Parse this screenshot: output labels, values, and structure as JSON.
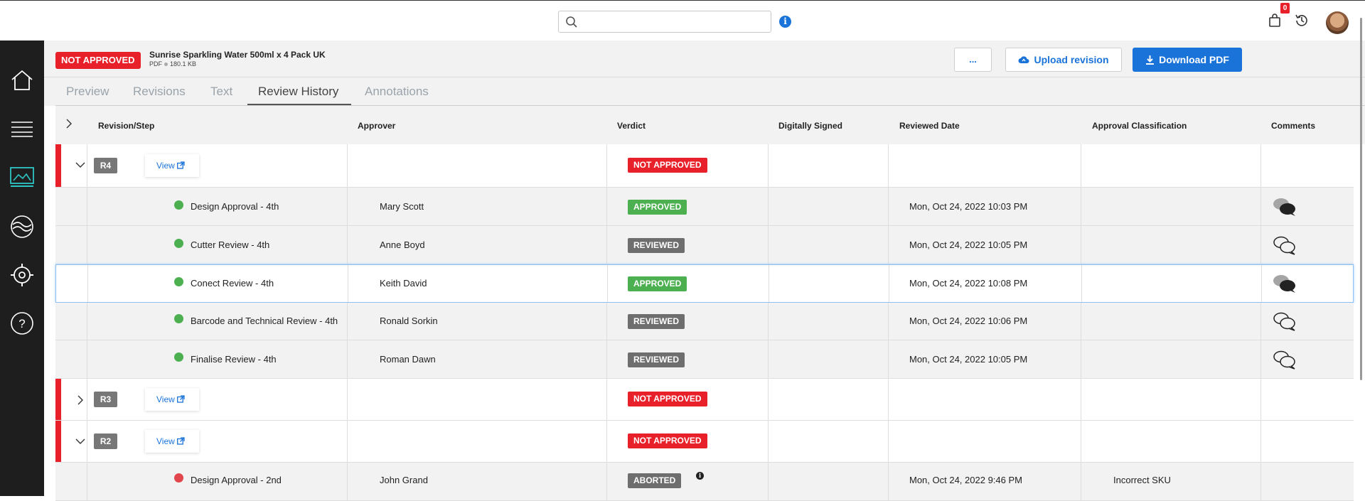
{
  "topbar": {
    "search_placeholder": "",
    "info_glyph": "i",
    "cart_count": "0"
  },
  "sidebar": {
    "items": [
      "home",
      "list",
      "artwork",
      "layers",
      "settings",
      "help"
    ],
    "active": "artwork"
  },
  "document": {
    "status": "NOT APPROVED",
    "title": "Sunrise Sparkling Water 500ml x 4 Pack UK",
    "file_type": "PDF",
    "file_size": "180.1 KB"
  },
  "actions": {
    "more_label": "...",
    "upload_label": "Upload revision",
    "download_label": "Download PDF"
  },
  "tabs": [
    "Preview",
    "Revisions",
    "Text",
    "Review History",
    "Annotations"
  ],
  "active_tab": "Review History",
  "columns": {
    "step": "Revision/Step",
    "approver": "Approver",
    "verdict": "Verdict",
    "signed": "Digitally Signed",
    "date": "Reviewed Date",
    "classification": "Approval Classification",
    "comments": "Comments"
  },
  "revisions": [
    {
      "id": "R4",
      "view_label": "View",
      "verdict": "NOT APPROVED",
      "expanded": true,
      "steps": [
        {
          "name": "Design Approval - 4th",
          "approver": "Mary Scott",
          "verdict": "APPROVED",
          "date": "Mon, Oct 24, 2022 10:03 PM",
          "classification": "",
          "has_comments": true
        },
        {
          "name": "Cutter Review - 4th",
          "approver": "Anne Boyd",
          "verdict": "REVIEWED",
          "date": "Mon, Oct 24, 2022 10:05 PM",
          "classification": "",
          "has_comments": false
        },
        {
          "name": "Conect Review - 4th",
          "approver": "Keith David",
          "verdict": "APPROVED",
          "date": "Mon, Oct 24, 2022 10:08 PM",
          "classification": "",
          "has_comments": true,
          "selected": true
        },
        {
          "name": "Barcode and Technical Review - 4th",
          "approver": "Ronald Sorkin",
          "verdict": "REVIEWED",
          "date": "Mon, Oct 24, 2022 10:06 PM",
          "classification": "",
          "has_comments": false
        },
        {
          "name": "Finalise Review - 4th",
          "approver": "Roman Dawn",
          "verdict": "REVIEWED",
          "date": "Mon, Oct 24, 2022 10:05 PM",
          "classification": "",
          "has_comments": false
        }
      ]
    },
    {
      "id": "R3",
      "view_label": "View",
      "verdict": "NOT APPROVED",
      "expanded": false,
      "steps": []
    },
    {
      "id": "R2",
      "view_label": "View",
      "verdict": "NOT APPROVED",
      "expanded": true,
      "steps": [
        {
          "name": "Design Approval - 2nd",
          "approver": "John Grand",
          "verdict": "ABORTED",
          "date": "Mon, Oct 24, 2022 9:46 PM",
          "classification": "Incorrect SKU",
          "has_comments": false
        }
      ]
    }
  ],
  "colors": {
    "red": "#e8202a",
    "green": "#4cb050",
    "gray": "#6e6e6e",
    "blue": "#1a73d9",
    "sidebar": "#1e1e1e"
  }
}
